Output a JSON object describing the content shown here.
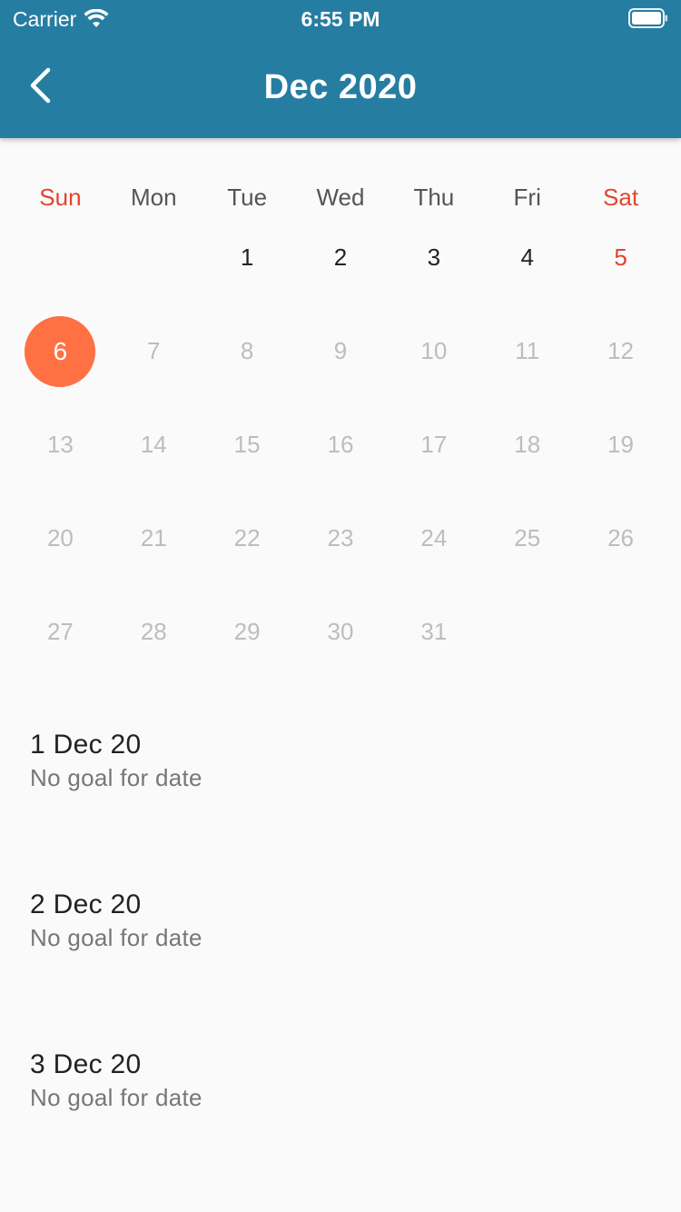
{
  "status_bar": {
    "carrier": "Carrier",
    "time": "6:55 PM",
    "icons": [
      "wifi-icon",
      "battery-icon"
    ]
  },
  "header": {
    "title": "Dec 2020",
    "back_icon": "chevron-left-icon",
    "background": "#267da2"
  },
  "calendar": {
    "weekdays": [
      "Sun",
      "Mon",
      "Tue",
      "Wed",
      "Thu",
      "Fri",
      "Sat"
    ],
    "weekend_color": "#e0452f",
    "selected_color": "#ff7043",
    "selected_day": "6",
    "leading_blank_days": 2,
    "days": [
      {
        "label": "1",
        "state": "active"
      },
      {
        "label": "2",
        "state": "active"
      },
      {
        "label": "3",
        "state": "active"
      },
      {
        "label": "4",
        "state": "active"
      },
      {
        "label": "5",
        "state": "weekend-active"
      },
      {
        "label": "6",
        "state": "selected"
      },
      {
        "label": "7",
        "state": "inactive"
      },
      {
        "label": "8",
        "state": "inactive"
      },
      {
        "label": "9",
        "state": "inactive"
      },
      {
        "label": "10",
        "state": "inactive"
      },
      {
        "label": "11",
        "state": "inactive"
      },
      {
        "label": "12",
        "state": "inactive"
      },
      {
        "label": "13",
        "state": "inactive"
      },
      {
        "label": "14",
        "state": "inactive"
      },
      {
        "label": "15",
        "state": "inactive"
      },
      {
        "label": "16",
        "state": "inactive"
      },
      {
        "label": "17",
        "state": "inactive"
      },
      {
        "label": "18",
        "state": "inactive"
      },
      {
        "label": "19",
        "state": "inactive"
      },
      {
        "label": "20",
        "state": "inactive"
      },
      {
        "label": "21",
        "state": "inactive"
      },
      {
        "label": "22",
        "state": "inactive"
      },
      {
        "label": "23",
        "state": "inactive"
      },
      {
        "label": "24",
        "state": "inactive"
      },
      {
        "label": "25",
        "state": "inactive"
      },
      {
        "label": "26",
        "state": "inactive"
      },
      {
        "label": "27",
        "state": "inactive"
      },
      {
        "label": "28",
        "state": "inactive"
      },
      {
        "label": "29",
        "state": "inactive"
      },
      {
        "label": "30",
        "state": "inactive"
      },
      {
        "label": "31",
        "state": "inactive"
      }
    ]
  },
  "goals": [
    {
      "date": "1 Dec 20",
      "status": "No goal for date"
    },
    {
      "date": "2 Dec 20",
      "status": "No goal for date"
    },
    {
      "date": "3 Dec 20",
      "status": "No goal for date"
    }
  ]
}
